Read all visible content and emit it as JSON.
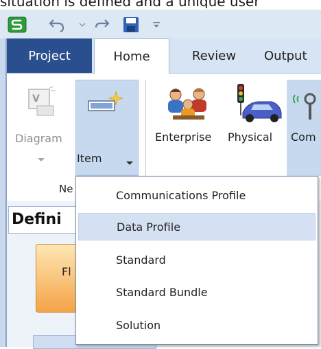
{
  "top_partial_text": "situation is defined and a unique user",
  "quick_access": {
    "app_icon": "s-logo-icon",
    "undo_icon": "undo-icon",
    "redo_icon": "redo-icon",
    "save_icon": "save-icon",
    "customize_icon": "customize-icon"
  },
  "tabs": [
    {
      "label": "Project"
    },
    {
      "label": "Home"
    },
    {
      "label": "Review"
    },
    {
      "label": "Output"
    }
  ],
  "ribbon": {
    "diagram_label": "Diagram",
    "item_label": "Item",
    "enterprise_label": "Enterprise",
    "physical_label": "Physical",
    "com_label": "Com",
    "group_label_partial": "Ne"
  },
  "panel": {
    "title": "Defini",
    "fl_text": "Fl"
  },
  "menu": {
    "items": [
      {
        "label": "Communications Profile"
      },
      {
        "label": "Data Profile"
      },
      {
        "label": "Standard"
      },
      {
        "label": "Standard Bundle"
      },
      {
        "label": "Solution"
      }
    ]
  },
  "colors": {
    "project_tab": "#2a4f8f",
    "ribbon_highlight": "#c7d9ee",
    "menu_highlight": "#d5e1f2"
  }
}
